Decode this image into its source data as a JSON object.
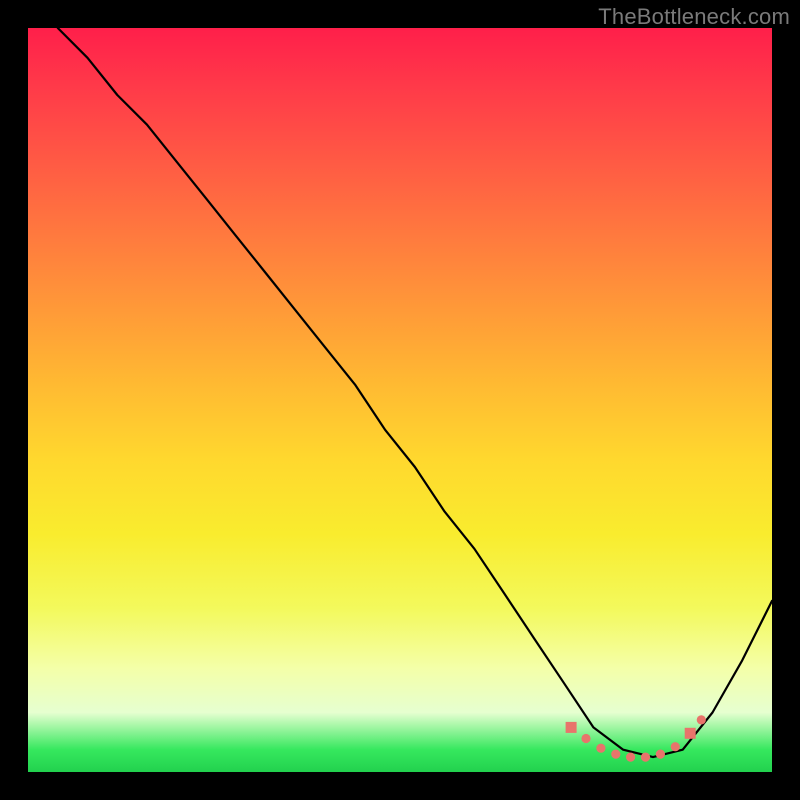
{
  "watermark": "TheBottleneck.com",
  "colors": {
    "curve": "#000000",
    "marker": "#e8746b",
    "frame": "#000000"
  },
  "chart_data": {
    "type": "line",
    "title": "",
    "xlabel": "",
    "ylabel": "",
    "xlim": [
      0,
      100
    ],
    "ylim": [
      0,
      100
    ],
    "grid": false,
    "legend": false,
    "axes_hidden": true,
    "series": [
      {
        "name": "bottleneck-curve",
        "x": [
          4,
          8,
          12,
          16,
          20,
          24,
          28,
          32,
          36,
          40,
          44,
          48,
          52,
          56,
          60,
          64,
          68,
          72,
          76,
          80,
          84,
          88,
          92,
          96,
          100
        ],
        "y": [
          100,
          96,
          91,
          87,
          82,
          77,
          72,
          67,
          62,
          57,
          52,
          46,
          41,
          35,
          30,
          24,
          18,
          12,
          6,
          3,
          2,
          3,
          8,
          15,
          23
        ]
      }
    ],
    "markers": [
      {
        "shape": "square",
        "x": 73,
        "y": 6
      },
      {
        "shape": "circle",
        "x": 75,
        "y": 4.5
      },
      {
        "shape": "circle",
        "x": 77,
        "y": 3.2
      },
      {
        "shape": "circle",
        "x": 79,
        "y": 2.4
      },
      {
        "shape": "circle",
        "x": 81,
        "y": 2.0
      },
      {
        "shape": "circle",
        "x": 83,
        "y": 2.0
      },
      {
        "shape": "circle",
        "x": 85,
        "y": 2.4
      },
      {
        "shape": "circle",
        "x": 87,
        "y": 3.4
      },
      {
        "shape": "square",
        "x": 89,
        "y": 5.2
      },
      {
        "shape": "circle",
        "x": 90.5,
        "y": 7.0
      }
    ],
    "gradient_stops": [
      {
        "pos": 0,
        "color": "#ff1f4a"
      },
      {
        "pos": 18,
        "color": "#ff5a44"
      },
      {
        "pos": 38,
        "color": "#ff9a38"
      },
      {
        "pos": 58,
        "color": "#ffd82e"
      },
      {
        "pos": 78,
        "color": "#f3f95c"
      },
      {
        "pos": 92,
        "color": "#e6ffd0"
      },
      {
        "pos": 100,
        "color": "#22d14e"
      }
    ]
  }
}
